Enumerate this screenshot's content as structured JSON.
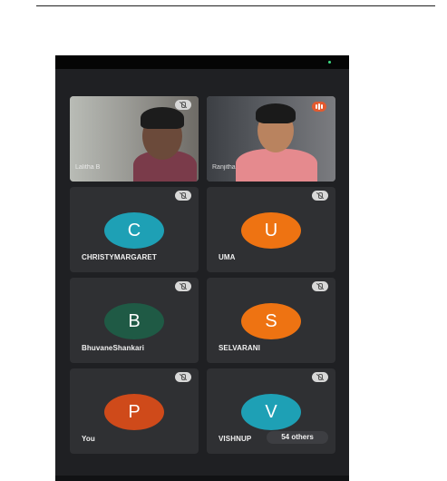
{
  "colors": {
    "call_background": "#1f2023",
    "tile_background": "#2f3033",
    "avatar_teal": "#1ea0b5",
    "avatar_orange": "#ee7312",
    "avatar_green": "#1f5a45",
    "avatar_red": "#cf4a1a"
  },
  "video_tiles": [
    {
      "caption": "Lalitha B",
      "mic_icon": "mic-muted-icon"
    },
    {
      "caption": "Ranjitha",
      "audio_icon": "audio-level-icon"
    }
  ],
  "participants": [
    {
      "initial": "C",
      "name": "CHRISTYMARGARET",
      "color": "#1ea0b5",
      "mic_icon": "mic-muted-icon"
    },
    {
      "initial": "U",
      "name": "UMA",
      "color": "#ee7312",
      "mic_icon": "mic-muted-icon"
    },
    {
      "initial": "B",
      "name": "BhuvaneShankari",
      "color": "#1f5a45",
      "mic_icon": "mic-muted-icon"
    },
    {
      "initial": "S",
      "name": "SELVARANI",
      "color": "#ee7312",
      "mic_icon": "mic-muted-icon"
    },
    {
      "initial": "P",
      "name": "You",
      "color": "#cf4a1a",
      "mic_icon": "mic-muted-icon"
    },
    {
      "initial": "V",
      "name": "VISHNUP",
      "color": "#1ea0b5",
      "mic_icon": "mic-muted-icon"
    }
  ],
  "others_chip": "54 others"
}
